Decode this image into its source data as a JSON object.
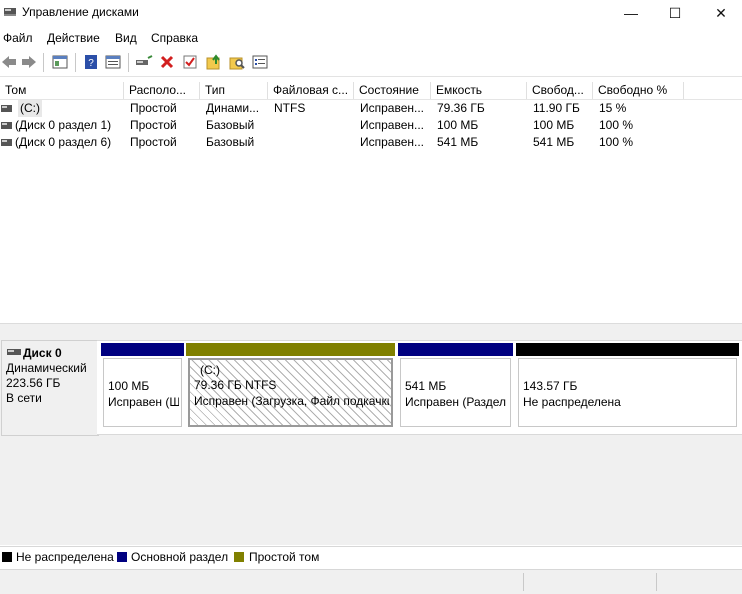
{
  "window": {
    "title": "Управление дисками",
    "min_symbol": "—",
    "max_symbol": "☐",
    "close_symbol": "✕"
  },
  "menu": [
    "Файл",
    "Действие",
    "Вид",
    "Справка"
  ],
  "toolbar_icons": [
    "back-arrow-icon",
    "forward-arrow-icon",
    "console-tree-icon",
    "help-icon",
    "properties-icon",
    "connect-disk-icon",
    "delete-icon",
    "check-icon",
    "upload-folder-icon",
    "search-folder-icon",
    "properties-list-icon"
  ],
  "columns": [
    "Том",
    "Располо...",
    "Тип",
    "Файловая с...",
    "Состояние",
    "Емкость",
    "Свобод...",
    "Свободно %"
  ],
  "volumes": [
    {
      "name": "(C:)",
      "layout": "Простой",
      "type": "Динами...",
      "fs": "NTFS",
      "status": "Исправен...",
      "capacity": "79.36 ГБ",
      "free": "11.90 ГБ",
      "free_pct": "15 %"
    },
    {
      "name": "(Диск 0 раздел 1)",
      "layout": "Простой",
      "type": "Базовый",
      "fs": "",
      "status": "Исправен...",
      "capacity": "100 МБ",
      "free": "100 МБ",
      "free_pct": "100 %"
    },
    {
      "name": "(Диск 0 раздел 6)",
      "layout": "Простой",
      "type": "Базовый",
      "fs": "",
      "status": "Исправен...",
      "capacity": "541 МБ",
      "free": "541 МБ",
      "free_pct": "100 %"
    }
  ],
  "disk": {
    "name": "Диск 0",
    "type": "Динамический",
    "size": "223.56 ГБ",
    "state": "В сети"
  },
  "partitions": [
    {
      "label": "",
      "size": "100 МБ",
      "status": "Исправен (Ш",
      "bar_color": "#000080"
    },
    {
      "label": "(C:)",
      "size": "79.36 ГБ NTFS",
      "status": "Исправен (Загрузка, Файл подкачки",
      "bar_color": "#808000"
    },
    {
      "label": "",
      "size": "541 МБ",
      "status": "Исправен (Раздел",
      "bar_color": "#000080"
    },
    {
      "label": "",
      "size": "143.57 ГБ",
      "status": "Не распределена",
      "bar_color": "#000000"
    }
  ],
  "legend": [
    {
      "label": "Не распределена",
      "color": "#000000"
    },
    {
      "label": "Основной раздел",
      "color": "#000080"
    },
    {
      "label": "Простой том",
      "color": "#808000"
    }
  ]
}
